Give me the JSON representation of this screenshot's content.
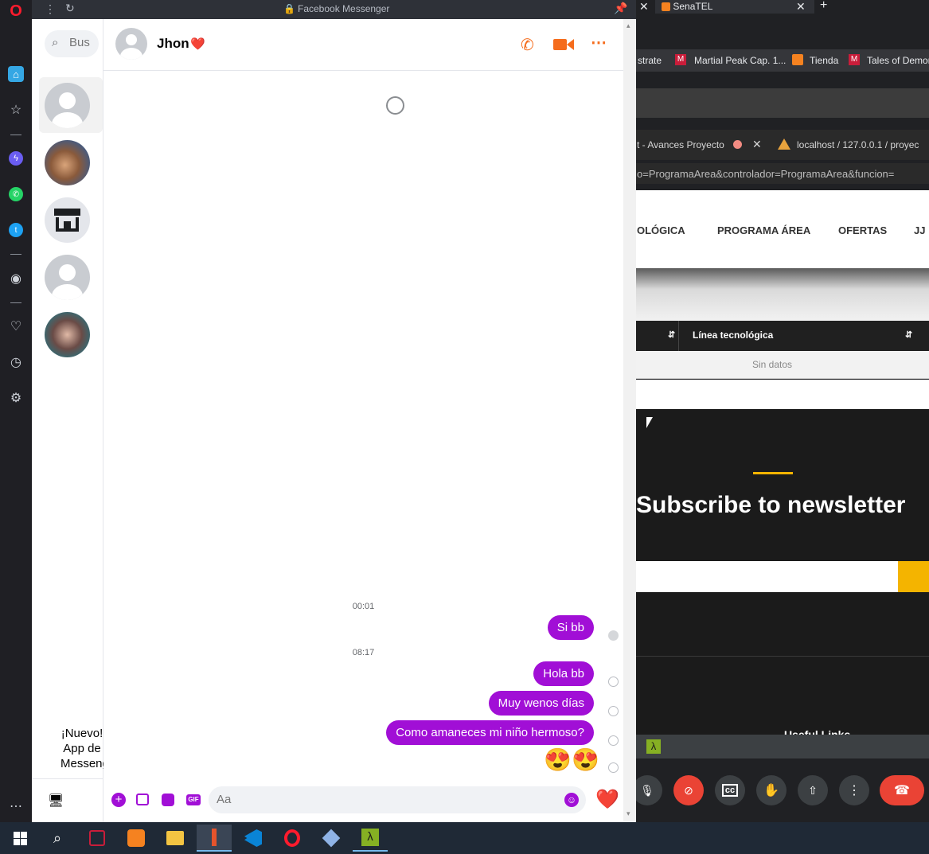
{
  "window": {
    "title": "Facebook Messenger"
  },
  "search": {
    "placeholder": "Bus"
  },
  "chat": {
    "contact_name": "Jhon",
    "contact_emoji": "❤️",
    "timestamps": [
      "00:01",
      "08:17"
    ],
    "messages": [
      {
        "text": "Si bb"
      },
      {
        "text": "Hola bb"
      },
      {
        "text": "Muy wenos días"
      },
      {
        "text": "Como amaneces mi niño hermoso?"
      },
      {
        "text": "😍😍"
      }
    ],
    "composer_placeholder": "Aa",
    "like_emoji": "❤️"
  },
  "promo": {
    "text": "¡Nuevo! App de Messenger"
  },
  "browser": {
    "tab": "SenaTEL",
    "bookmarks": [
      "strate",
      "Martial Peak Cap. 1...",
      "Tienda",
      "Tales of Demor"
    ],
    "tab2_left": "t - Avances Proyecto",
    "tab2_right": "localhost / 127.0.0.1 / proyec",
    "url": "o=ProgramaArea&controlador=ProgramaArea&funcion=",
    "nav": [
      "OLÓGICA",
      "PROGRAMA ÁREA",
      "OFERTAS",
      "JJ"
    ],
    "table_header": "Línea tecnológica",
    "table_empty": "Sin datos",
    "newsletter": "Subscribe to newsletter",
    "useful": "Useful Links",
    "lambda": "λ"
  },
  "colors": {
    "accent": "#a10fd6",
    "orange": "#f56c1c",
    "red": "#e42b2b"
  }
}
